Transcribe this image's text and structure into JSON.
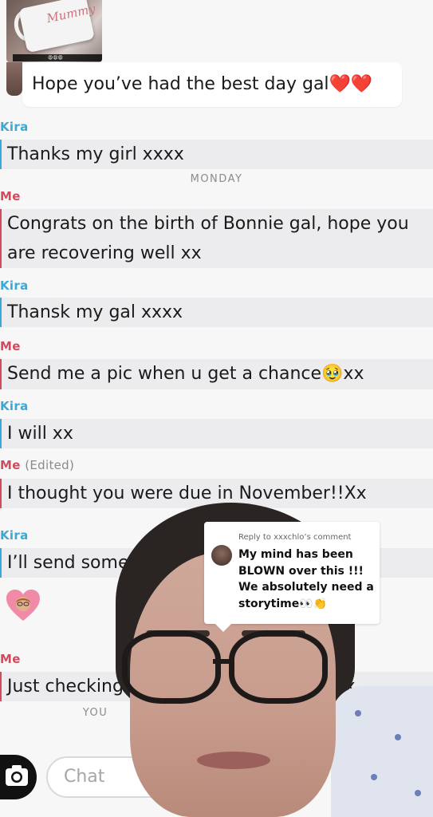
{
  "top_image": {
    "mug_text": "Mummy",
    "caption_emoji": "😩😩😩"
  },
  "messages": [
    {
      "text": "Hope you’ve had the best day gal❤️❤️"
    },
    {
      "sender": "Kira",
      "text": "Thanks my girl xxxx"
    },
    {
      "day": "MONDAY"
    },
    {
      "sender": "Me",
      "text": "Congrats on the birth of Bonnie gal, hope you are recovering well xx"
    },
    {
      "sender": "Kira",
      "text": "Thansk my gal xxxx"
    },
    {
      "sender": "Me",
      "text": "Send me a pic when u get a chance🥹xx"
    },
    {
      "sender": "Kira",
      "text": "I will xx"
    },
    {
      "sender": "Me",
      "edited": "(Edited)",
      "text": "I thought you were due in November!!Xx"
    },
    {
      "sender": "Kira",
      "text": "I’ll send some"
    },
    {
      "sender": "Me",
      "text": "Just checking",
      "tail": "e x"
    },
    {
      "day": "YOU"
    }
  ],
  "heart_emoji": "💗",
  "chat_bar": {
    "placeholder": "Chat"
  },
  "comment_card": {
    "reply_to": "Reply to xxxchlo’s comment",
    "text": "My mind has been BLOWN over this !!! We absolutely need a storytime👀👏"
  },
  "colors": {
    "kira": "#3aa9d7",
    "me": "#d24b5c",
    "background": "#f7f7f8",
    "message_bg": "#ececee"
  }
}
